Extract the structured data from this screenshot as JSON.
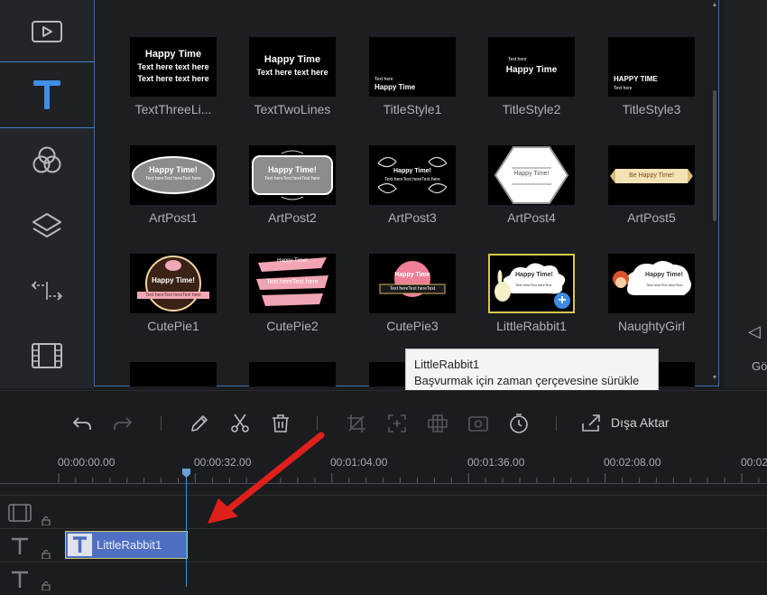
{
  "sidebar": {
    "items": [
      {
        "name": "media",
        "icon": "play-icon",
        "active": false
      },
      {
        "name": "text",
        "icon": "text-icon",
        "active": true
      },
      {
        "name": "filters",
        "icon": "filter-circles-icon",
        "active": false
      },
      {
        "name": "overlays",
        "icon": "layers-icon",
        "active": false
      },
      {
        "name": "transitions",
        "icon": "transition-arrows-icon",
        "active": false
      },
      {
        "name": "elements",
        "icon": "film-icon",
        "active": false
      }
    ]
  },
  "library": {
    "tiles": [
      {
        "label": "TextThreeLi...",
        "preview": [
          "Happy Time",
          "Text here text here",
          "Text here text here"
        ]
      },
      {
        "label": "TextTwoLines",
        "preview": [
          "Happy Time",
          "Text here text here"
        ]
      },
      {
        "label": "TitleStyle1",
        "preview": [
          "Text here",
          "Happy Time"
        ]
      },
      {
        "label": "TitleStyle2",
        "preview": [
          "Text here",
          "Happy Time"
        ]
      },
      {
        "label": "TitleStyle3",
        "preview": [
          "HAPPY TIME",
          "Text here"
        ]
      },
      {
        "label": "ArtPost1",
        "preview": [
          "Happy Time!",
          "Text hereText hereText here"
        ]
      },
      {
        "label": "ArtPost2",
        "preview": [
          "Happy Time!",
          "Text hereText hereText here"
        ]
      },
      {
        "label": "ArtPost3",
        "preview": [
          "Happy Time!",
          "Text hereText hereText here"
        ]
      },
      {
        "label": "ArtPost4",
        "preview": [
          "Happy Time!"
        ]
      },
      {
        "label": "ArtPost5",
        "preview": [
          "Be Happy Time!"
        ]
      },
      {
        "label": "CutePie1",
        "preview": [
          "Happy Time!",
          "Text hereText hereText here"
        ]
      },
      {
        "label": "CutePie2",
        "preview": [
          "Happy Time!",
          "Text hereText here"
        ]
      },
      {
        "label": "CutePie3",
        "preview": [
          "Happy Time",
          "Text hereText hereText"
        ]
      },
      {
        "label": "LittleRabbit1",
        "preview": [
          "Happy Time!",
          "Text hereText hereText"
        ],
        "selected": true
      },
      {
        "label": "NaughtyGirl",
        "preview": [
          "Happy Time!",
          "Text hereText hereText"
        ]
      }
    ]
  },
  "preview_panel": {
    "label": "Gö"
  },
  "tooltip": {
    "title": "LittleRabbit1",
    "body": "Başvurmak için zaman çerçevesine sürükle"
  },
  "toolbar": {
    "buttons": [
      "undo-icon",
      "redo-icon",
      "edit-icon",
      "cut-icon",
      "delete-icon",
      "crop-icon",
      "zoom-icon",
      "mosaic-icon",
      "freeze-frame-icon",
      "duration-icon",
      "export-icon"
    ],
    "export_label": "Dışa Aktar"
  },
  "timeline": {
    "timecodes": [
      "00:00:00.00",
      "00:00:32.00",
      "00:01:04.00",
      "00:01:36.00",
      "00:02:08.00",
      "00:02"
    ],
    "clip_label": "LittleRabbit1",
    "playhead_time": "00:00:32.00"
  },
  "colors": {
    "accent": "#3f7fc4",
    "clip": "#4e6fc2",
    "selection": "#d6c94a",
    "annotation": "#e0201a"
  }
}
